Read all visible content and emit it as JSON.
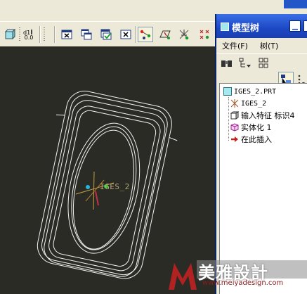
{
  "toolbar": {
    "sketch_badge": "0.0",
    "buttons": [
      {
        "icon": "view-box-icon"
      },
      {
        "icon": "measure-icon"
      },
      {
        "icon": "close-window-icon"
      },
      {
        "icon": "window-icon"
      },
      {
        "icon": "activate-window-icon"
      },
      {
        "icon": "close-icon"
      },
      {
        "icon": "datum-axis-icon"
      },
      {
        "icon": "datum-plane-icon"
      },
      {
        "icon": "csys-display-icon"
      },
      {
        "icon": "point-display-icon"
      }
    ]
  },
  "viewport": {
    "background": "#2b2b26",
    "model_label": "IGES_2"
  },
  "model_tree": {
    "title": "模型树",
    "menu": [
      {
        "label": "文件(F)"
      },
      {
        "label": "树(T)"
      }
    ],
    "items": [
      {
        "label": "IGES_2.PRT",
        "icon": "part-icon"
      },
      {
        "label": "IGES_2",
        "icon": "csys-icon"
      },
      {
        "label": "输入特征 标识4",
        "icon": "import-feature-icon"
      },
      {
        "label": "实体化 1",
        "icon": "solidify-icon"
      },
      {
        "label": "在此插入",
        "icon": "insert-here-arrow-icon"
      }
    ]
  },
  "watermark": {
    "logo_letter": "M",
    "name": "美雅設計",
    "url": "www.meiyadesign.com"
  },
  "colors": {
    "title_blue": "#1d48c4",
    "accent_red": "#b22222",
    "model_wire": "#f2f2f2"
  }
}
